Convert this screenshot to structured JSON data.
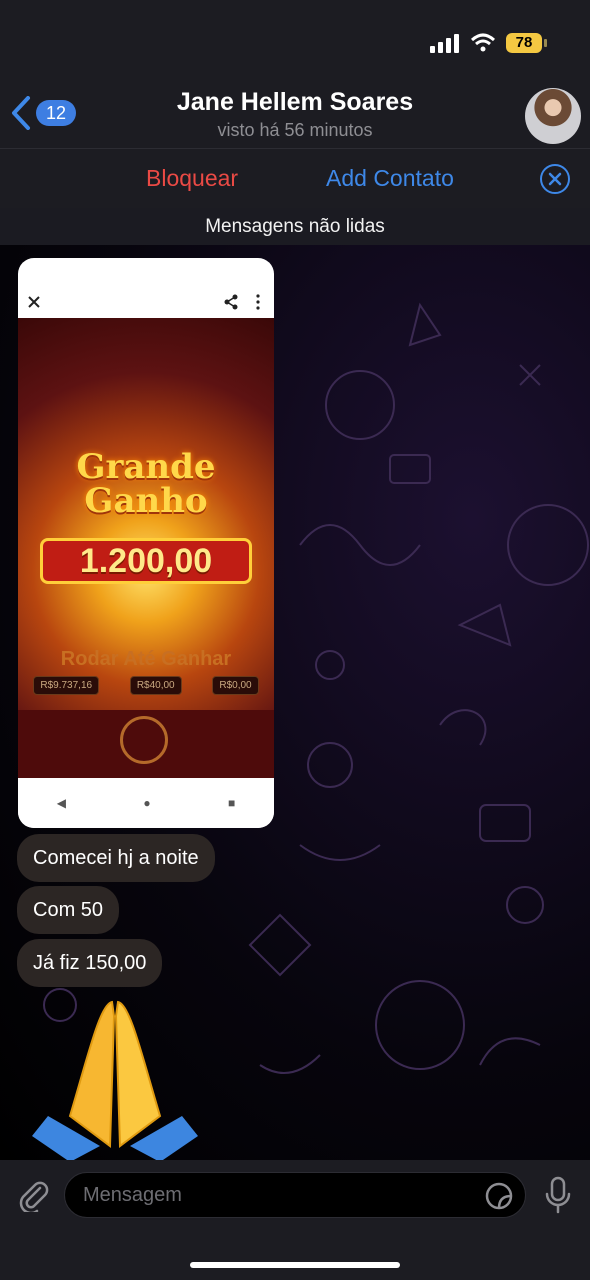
{
  "status_bar": {
    "battery": "78"
  },
  "nav": {
    "back_count": "12",
    "contact_name": "Jane Hellem Soares",
    "last_seen": "visto há 56 minutos"
  },
  "actions": {
    "block": "Bloquear",
    "add_contact": "Add Contato"
  },
  "unread_banner": "Mensagens não lidas",
  "shared_image": {
    "title_line1": "Grande",
    "title_line2": "Ganho",
    "amount": "1.200,00",
    "spin_label": "Rodar Até Ganhar",
    "stats": [
      "R$9.737,16",
      "R$40,00",
      "R$0,00"
    ]
  },
  "messages": [
    {
      "text": "Comecei hj a noite"
    },
    {
      "text": "Com 50"
    },
    {
      "text": "Já fiz 150,00"
    }
  ],
  "emoji_message": "folded-hands",
  "composer": {
    "placeholder": "Mensagem"
  },
  "colors": {
    "accent": "#3e88e8",
    "danger": "#ea4a45",
    "bubble": "#2c2624"
  }
}
